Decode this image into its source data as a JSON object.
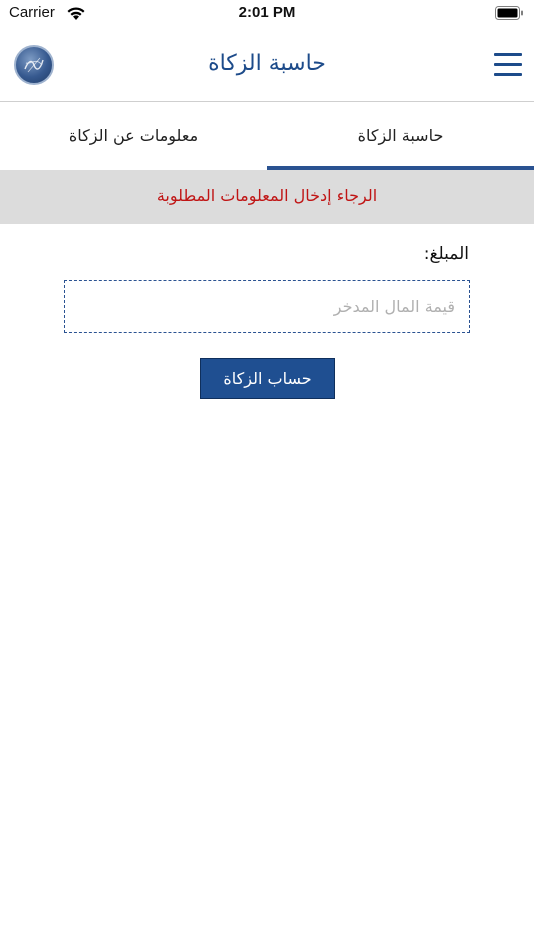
{
  "status_bar": {
    "carrier": "Carrier",
    "time": "2:01 PM",
    "icons": [
      "wifi-icon",
      "battery-icon"
    ]
  },
  "header": {
    "title": "حاسبة الزكاة",
    "logo": "calligraphy-logo-icon",
    "menu_icon": "hamburger-menu-icon"
  },
  "tabs": [
    {
      "label": "حاسبة الزكاة",
      "active": true
    },
    {
      "label": "معلومات عن الزكاة",
      "active": false
    }
  ],
  "banner": {
    "message": "الرجاء إدخال المعلومات المطلوبة"
  },
  "form": {
    "amount_label": "المبلغ:",
    "amount_value": "",
    "amount_placeholder": "قيمة المال المدخر",
    "submit_label": "حساب الزكاة"
  },
  "colors": {
    "brand_blue": "#1d4b8a",
    "button_blue": "#1f4f91",
    "error_red": "#c01515",
    "banner_gray": "#dcdcdc"
  }
}
